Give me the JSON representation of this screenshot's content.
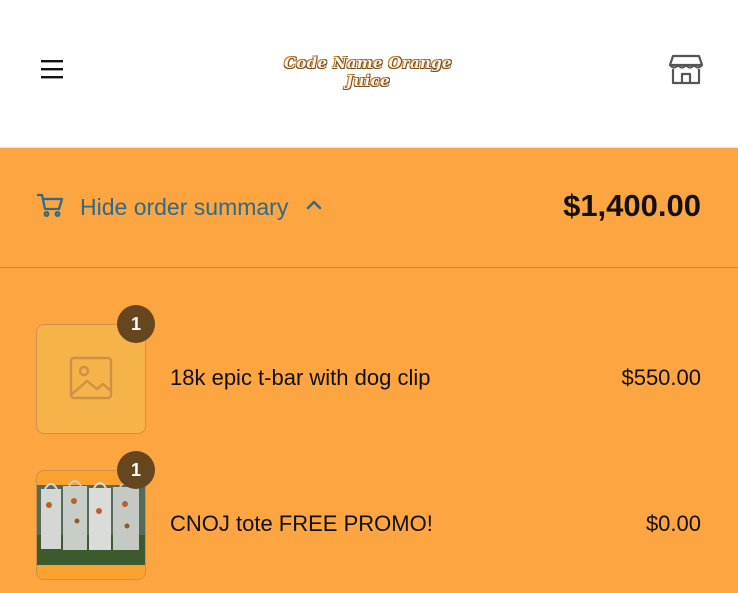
{
  "header": {
    "logo_text": "Code Name Orange Juice",
    "menu_icon": "hamburger-menu-icon",
    "store_icon": "storefront-icon"
  },
  "summary": {
    "toggle_label": "Hide order summary",
    "total": "$1,400.00",
    "cart_icon": "cart-icon",
    "chevron_icon": "chevron-up-icon"
  },
  "items": [
    {
      "quantity": "1",
      "name": "18k epic t-bar with dog clip",
      "price": "$550.00",
      "image": "placeholder-image-icon"
    },
    {
      "quantity": "1",
      "name": "CNOJ tote FREE PROMO!",
      "price": "$0.00",
      "image": "tote-bags-photo"
    }
  ],
  "colors": {
    "accent_orange": "#fda540",
    "link_blue": "#2f6a87",
    "badge_brown": "#66461f"
  }
}
